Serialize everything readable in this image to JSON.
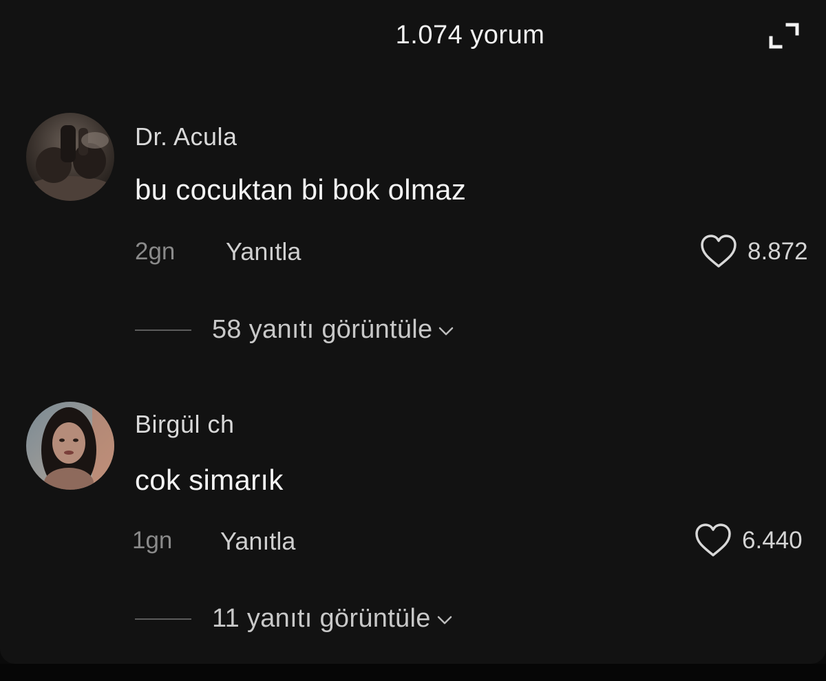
{
  "header": {
    "title": "1.074 yorum",
    "expand_icon": "expand-icon"
  },
  "comments": [
    {
      "username": "Dr. Acula",
      "text": "bu cocuktan bi bok olmaz",
      "time": "2gn",
      "reply_label": "Yanıtla",
      "likes": "8.872",
      "view_replies": "58 yanıtı görüntüle",
      "avatar_icon": "avatar"
    },
    {
      "username": "Birgül ch",
      "text": "cok simarık",
      "time": "1gn",
      "reply_label": "Yanıtla",
      "likes": "6.440",
      "view_replies": "11 yanıtı görüntüle",
      "avatar_icon": "avatar"
    }
  ],
  "icons": {
    "like": "heart-icon",
    "chevron": "chevron-down-icon"
  },
  "colors": {
    "background": "#121212",
    "text_primary": "#f4f4f4",
    "text_secondary": "#8a8a8a"
  }
}
